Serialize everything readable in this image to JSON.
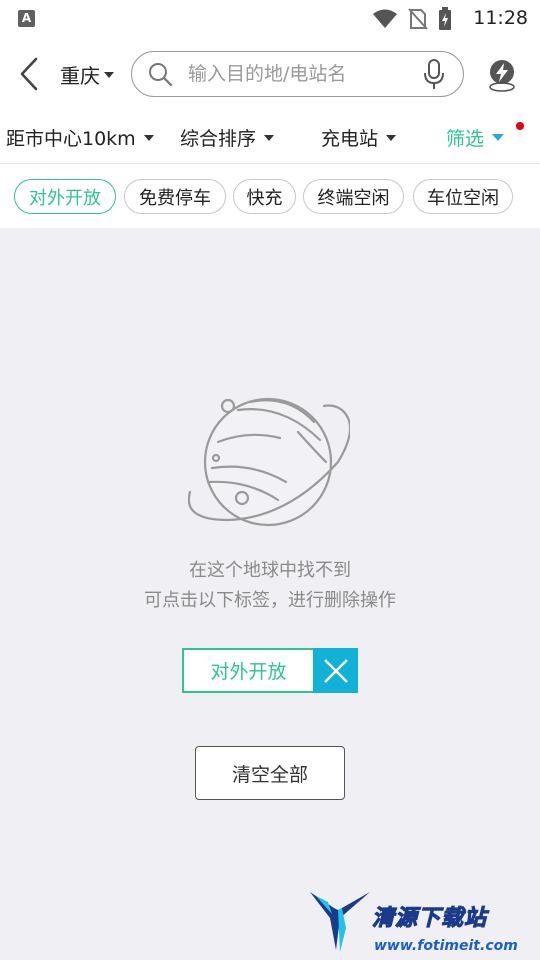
{
  "status_bar": {
    "app_icon_letter": "A",
    "time": "11:28"
  },
  "top_bar": {
    "city": "重庆",
    "search_placeholder": "输入目的地/电站名",
    "search_value": ""
  },
  "filter_bar": {
    "items": [
      {
        "label": "距市中心10km"
      },
      {
        "label": "综合排序"
      },
      {
        "label": "充电站"
      },
      {
        "label": "筛选",
        "active": true
      }
    ]
  },
  "tags": [
    {
      "label": "对外开放",
      "selected": true
    },
    {
      "label": "免费停车",
      "selected": false
    },
    {
      "label": "快充",
      "selected": false
    },
    {
      "label": "终端空闲",
      "selected": false
    },
    {
      "label": "车位空闲",
      "selected": false
    }
  ],
  "empty_state": {
    "line1": "在这个地球中找不到",
    "line2": "可点击以下标签，进行删除操作",
    "active_tag": "对外开放",
    "clear_all_label": "清空全部"
  },
  "watermark": {
    "title": "清源下载站",
    "url": "www.fotimeit.com"
  },
  "colors": {
    "accent_green": "#2ec58f",
    "accent_blue": "#12b1d8",
    "notice_red": "#e60012",
    "background": "#efeff4"
  },
  "icons": [
    "back-arrow-icon",
    "caret-down-icon",
    "search-icon",
    "microphone-icon",
    "charging-location-icon",
    "close-icon",
    "planet-icon",
    "wifi-icon",
    "no-sim-icon",
    "battery-charging-icon"
  ]
}
